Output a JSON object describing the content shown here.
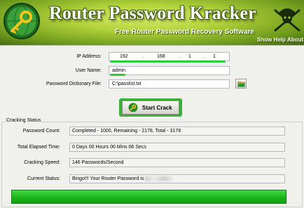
{
  "header": {
    "title": "Router Password Kracker",
    "subtitle": "Free Router Password Recovery Software",
    "menu": {
      "show_help": "Show Help",
      "about": "About"
    }
  },
  "form": {
    "ip_label": "IP Address:",
    "ip": [
      "192",
      "168",
      "1",
      "1"
    ],
    "ip_separator": ".",
    "user_label": "User Name:",
    "user_value": "admin",
    "dict_label": "Password Dictionary File:",
    "dict_value": "C:\\passlist.txt"
  },
  "start_button": {
    "label": "Start Crack"
  },
  "status": {
    "group_title": "Cracking Status",
    "password_count_label": "Password Count:",
    "password_count_value": "Completed - 1000,  Remaining - 2178, Total - 3178",
    "elapsed_label": "Total Elapsed Time:",
    "elapsed_value": "0 Days 00 Hours 00 Mins 06 Secs",
    "speed_label": "Cracking Speed:",
    "speed_value": "146 Passwords/Second",
    "current_label": "Current Status:",
    "current_value": "Bingo!!! Your Router Password is",
    "progress": 1.0
  },
  "colors": {
    "accent_green": "#2ccc3a",
    "banner_green": "#8ab828",
    "progress_green": "#1fb61f"
  },
  "icons": {
    "logo": "key-globe-icon",
    "mascot": "pirate-skull-icon",
    "browse": "folder-icon",
    "start": "key-icon"
  }
}
